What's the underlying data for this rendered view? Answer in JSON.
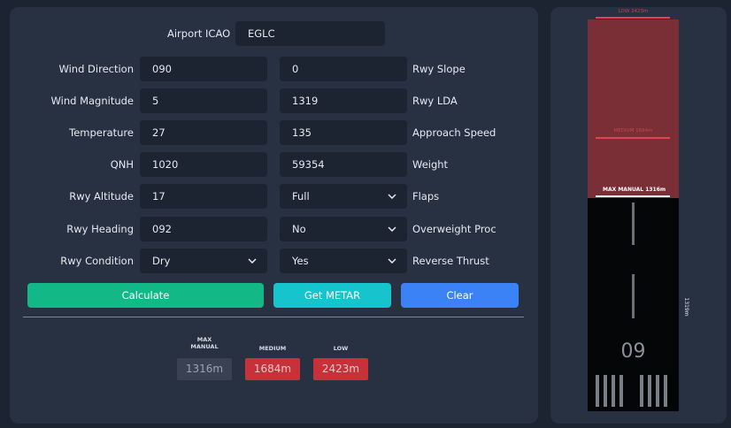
{
  "form": {
    "airport_icao": {
      "label": "Airport ICAO",
      "value": "EGLC"
    },
    "left": [
      {
        "label": "Wind Direction",
        "value": "090"
      },
      {
        "label": "Wind Magnitude",
        "value": "5"
      },
      {
        "label": "Temperature",
        "value": "27"
      },
      {
        "label": "QNH",
        "value": "1020"
      },
      {
        "label": "Rwy Altitude",
        "value": "17"
      },
      {
        "label": "Rwy Heading",
        "value": "092"
      },
      {
        "label": "Rwy Condition",
        "value": "Dry"
      }
    ],
    "right": [
      {
        "label": "Rwy Slope",
        "value": "0"
      },
      {
        "label": "Rwy LDA",
        "value": "1319"
      },
      {
        "label": "Approach Speed",
        "value": "135"
      },
      {
        "label": "Weight",
        "value": "59354"
      },
      {
        "label": "Flaps",
        "value": "Full"
      },
      {
        "label": "Overweight Proc",
        "value": "No"
      },
      {
        "label": "Reverse Thrust",
        "value": "Yes"
      }
    ]
  },
  "buttons": {
    "calculate": "Calculate",
    "get_metar": "Get METAR",
    "clear": "Clear"
  },
  "results": {
    "max_manual": {
      "label": "MAX MANUAL",
      "value": "1316m"
    },
    "medium": {
      "label": "MEDIUM",
      "value": "1684m"
    },
    "low": {
      "label": "LOW",
      "value": "2423m"
    }
  },
  "runway": {
    "max_manual_marker": "MAX MANUAL 1316m",
    "medium_marker": "MEDIUM 1684m",
    "low_marker": "LOW 2423m",
    "lda_label": "1319m",
    "runway_number": "09"
  },
  "colors": {
    "calculate": "#12b886",
    "get_metar": "#15c4cc",
    "clear": "#3b82f6",
    "danger": "#c9313a",
    "neutral_result": "#394152"
  },
  "icons": [
    "chevron-down-icon"
  ]
}
